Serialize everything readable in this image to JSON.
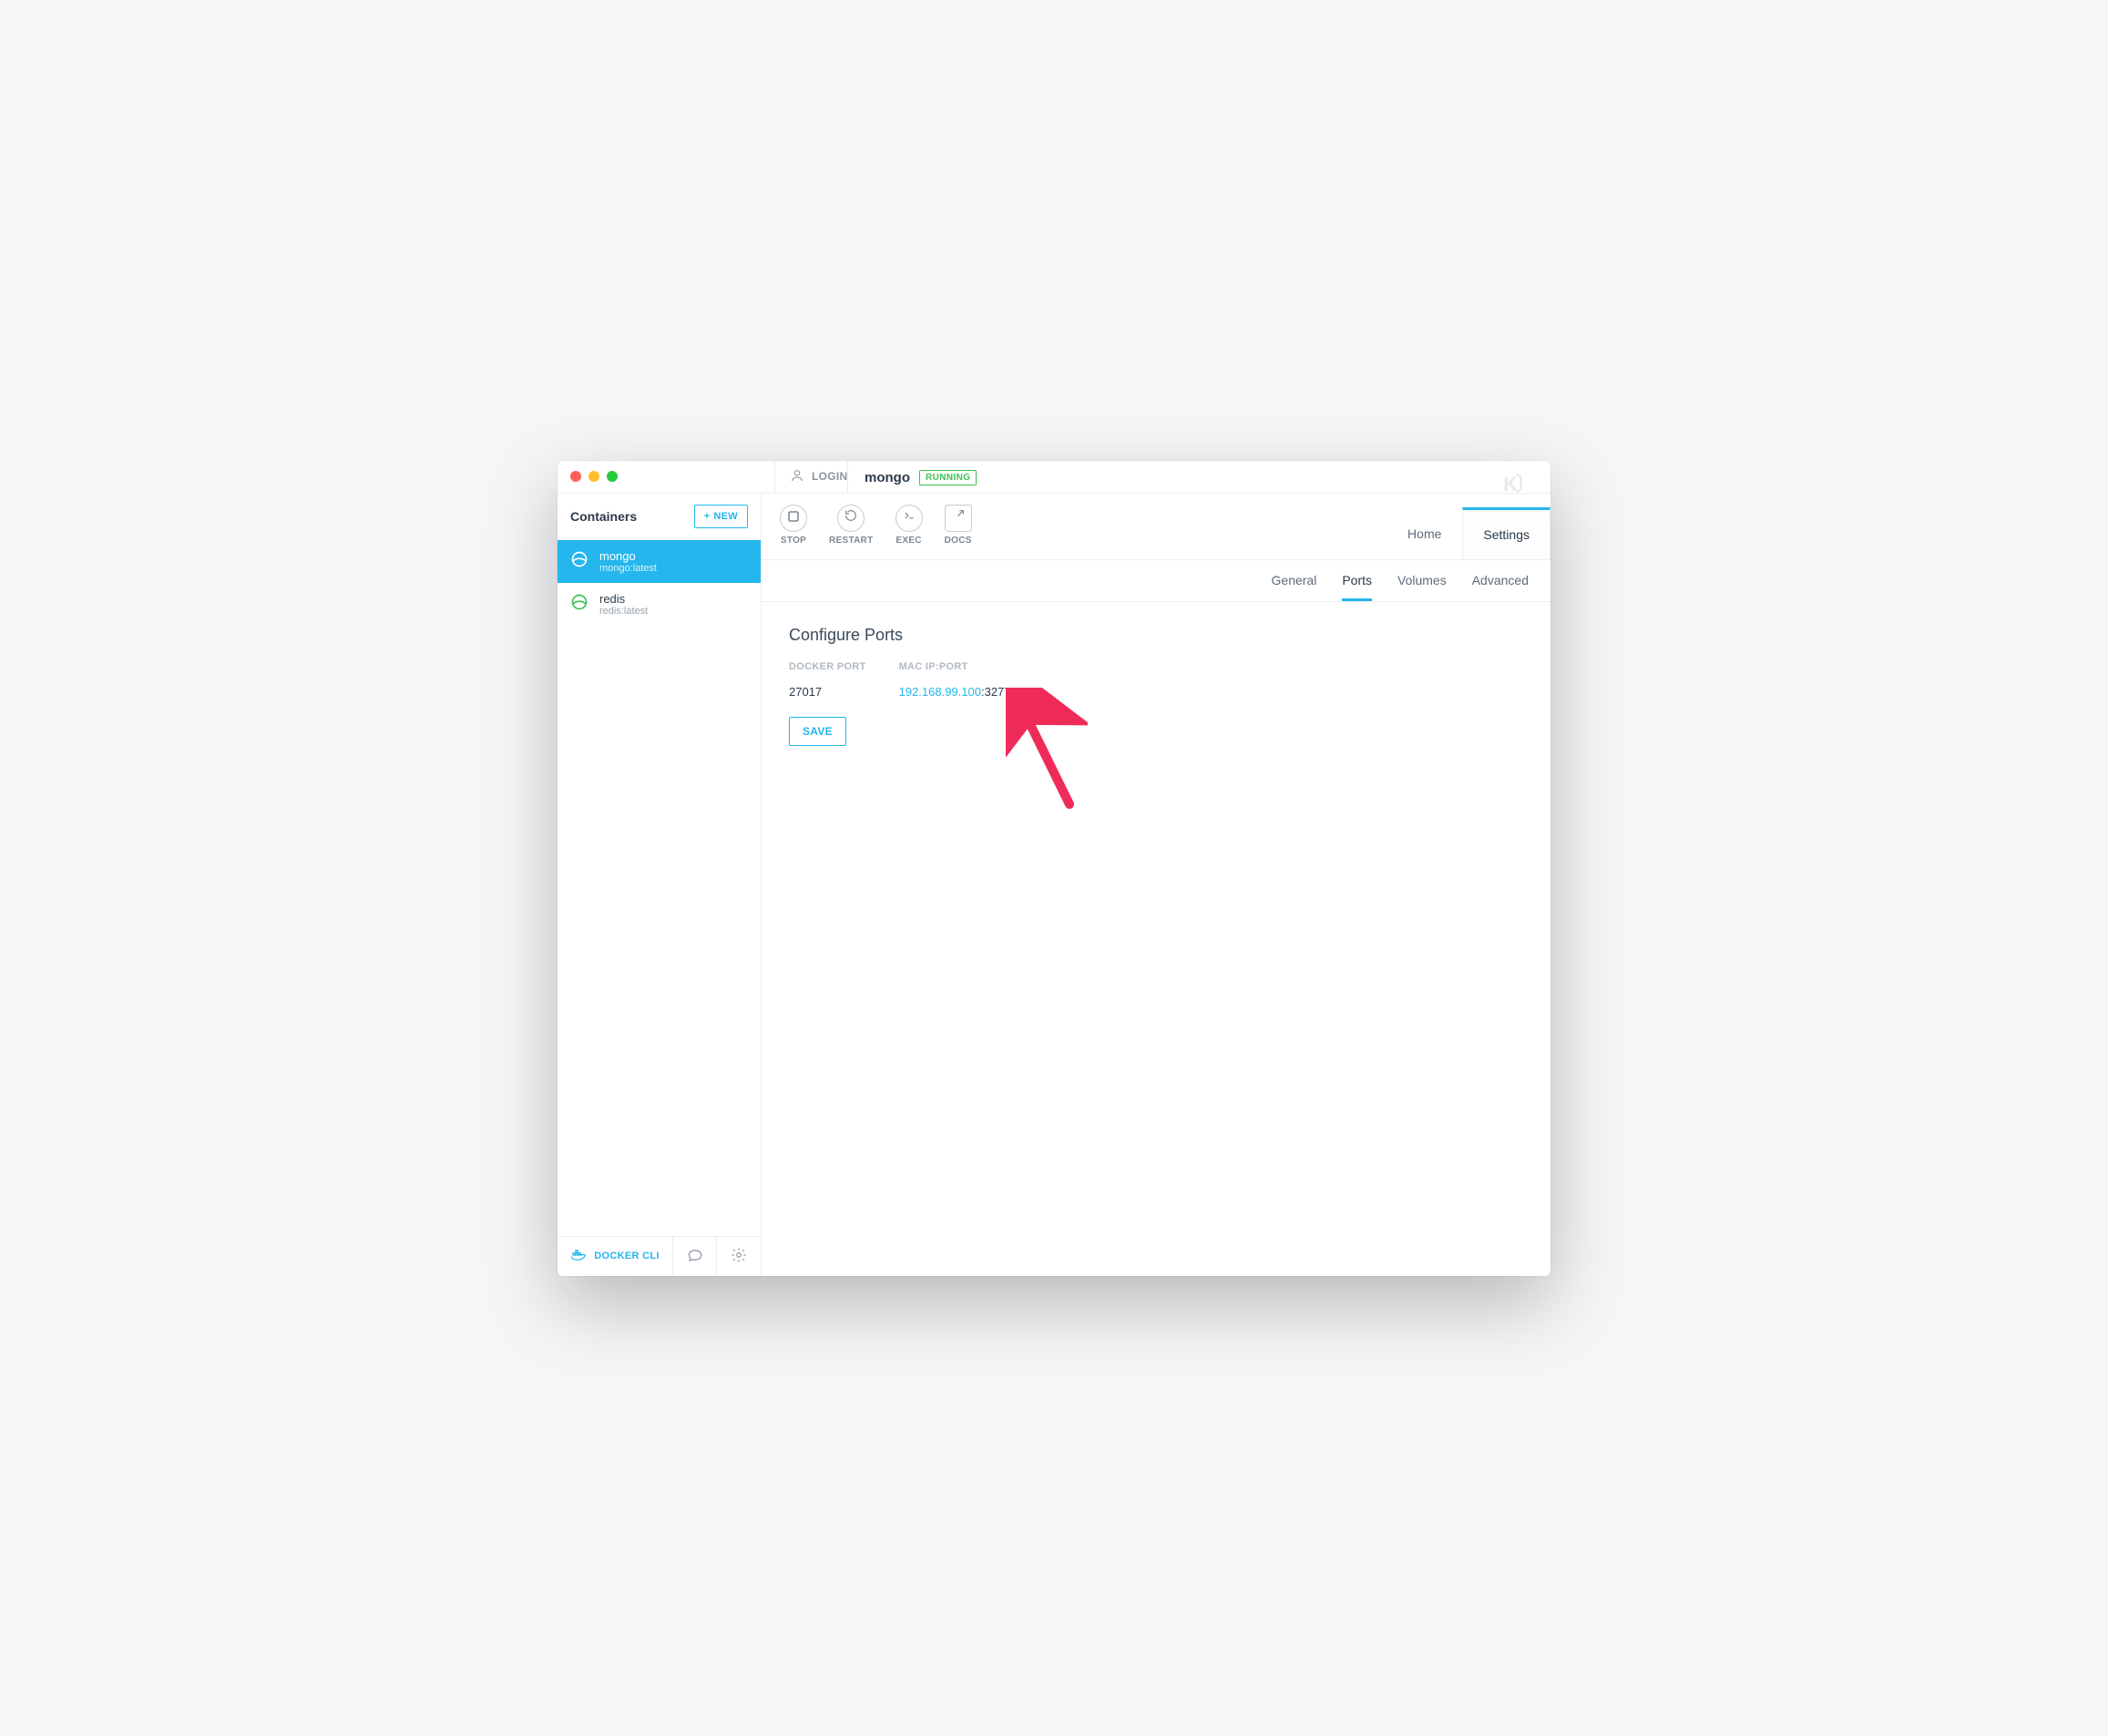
{
  "titlebar": {
    "login_label": "LOGIN"
  },
  "sidebar": {
    "title": "Containers",
    "new_label": "NEW",
    "items": [
      {
        "name": "mongo",
        "sub": "mongo:latest",
        "active": true
      },
      {
        "name": "redis",
        "sub": "redis:latest",
        "active": false
      }
    ],
    "footer": {
      "cli_label": "DOCKER CLI"
    }
  },
  "header": {
    "container_name": "mongo",
    "status": "RUNNING",
    "actions": [
      {
        "id": "stop",
        "label": "STOP"
      },
      {
        "id": "restart",
        "label": "RESTART"
      },
      {
        "id": "exec",
        "label": "EXEC"
      },
      {
        "id": "docs",
        "label": "DOCS"
      }
    ],
    "main_tabs": [
      {
        "id": "home",
        "label": "Home",
        "active": false
      },
      {
        "id": "settings",
        "label": "Settings",
        "active": true
      }
    ]
  },
  "settings": {
    "subtabs": [
      {
        "id": "general",
        "label": "General",
        "active": false
      },
      {
        "id": "ports",
        "label": "Ports",
        "active": true
      },
      {
        "id": "volumes",
        "label": "Volumes",
        "active": false
      },
      {
        "id": "advanced",
        "label": "Advanced",
        "active": false
      }
    ],
    "ports_panel": {
      "title": "Configure Ports",
      "col_docker": "DOCKER PORT",
      "col_mac": "MAC IP:PORT",
      "rows": [
        {
          "docker_port": "27017",
          "ip": "192.168.99.100",
          "host_port": "32770"
        }
      ],
      "save_label": "SAVE"
    }
  },
  "colors": {
    "accent": "#24b6ec",
    "running": "#3fbf54",
    "annotation": "#ef2b5a"
  }
}
